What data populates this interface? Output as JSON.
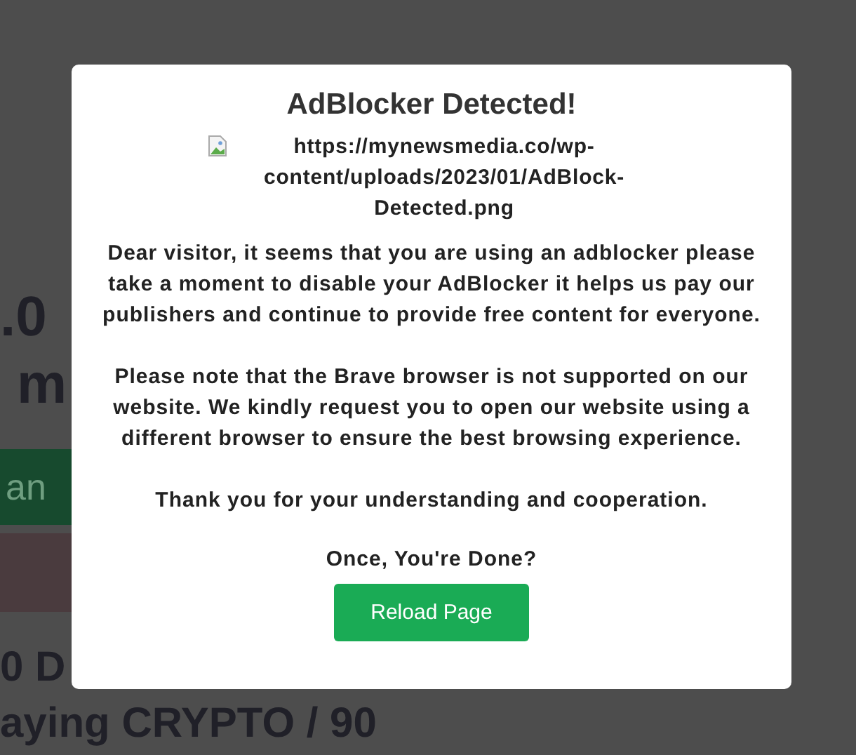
{
  "background_page": {
    "price": ".0",
    "price_unit": "m",
    "banner": "an",
    "heading_1": "0 D",
    "heading_2": "aying CRYPTO / 90"
  },
  "modal": {
    "title": "AdBlocker Detected!",
    "image_alt": "https://mynewsmedia.co/wp-content/uploads/2023/01/AdBlock-Detected.png",
    "paragraphs": [
      "Dear visitor, it seems that you are using an adblocker please take a moment to disable your AdBlocker it helps us pay our publishers and continue to provide free content for everyone.",
      "Please note that the Brave browser is not supported on our website. We kindly request you to open our website using a different browser to ensure the best browsing experience.",
      "Thank you for your understanding and cooperation."
    ],
    "prompt": "Once, You're Done?",
    "button": "Reload Page"
  }
}
